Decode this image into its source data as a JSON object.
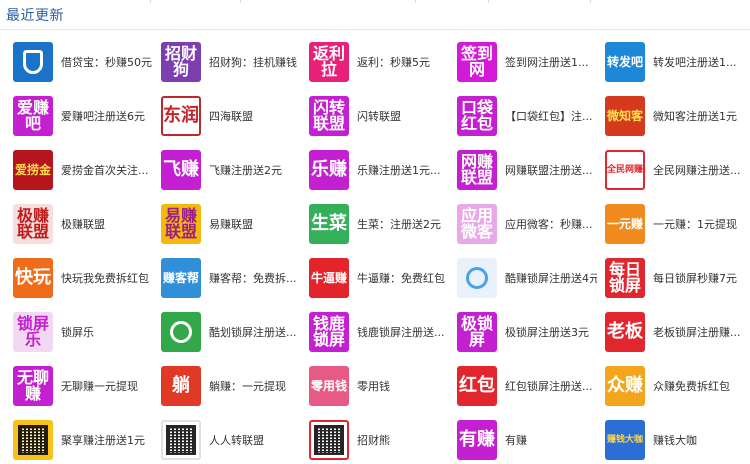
{
  "header": {
    "title": "最近更新"
  },
  "apps": [
    {
      "label": "借贷宝：秒赚50元",
      "icon_text": "",
      "icon_name": "jiedaibao-shield-icon",
      "bg": "#1a73c9",
      "fg": "#ffffff",
      "glyph": "shield"
    },
    {
      "label": "招财狗：挂机赚钱",
      "icon_text": "招财\n狗",
      "icon_name": "zhaocaigou-icon",
      "bg": "#7b3fb0",
      "fg": "#ffffff"
    },
    {
      "label": "返利：秒赚5元",
      "icon_text": "返利\n拉",
      "icon_name": "fanli-icon",
      "bg": "#e8207a",
      "fg": "#ffffff"
    },
    {
      "label": "签到网注册送1...",
      "icon_text": "签到\n网",
      "icon_name": "qiandaowang-icon",
      "bg": "#d21ad8",
      "fg": "#ffffff"
    },
    {
      "label": "转发吧注册送1...",
      "icon_text": "转发吧",
      "icon_name": "zhuanfaba-icon",
      "bg": "#1e88d8",
      "fg": "#ffffff"
    },
    {
      "label": "爱赚吧注册送6元",
      "icon_text": "爱赚\n吧",
      "icon_name": "aizhuanba-icon",
      "bg": "#c41fd0",
      "fg": "#ffffff"
    },
    {
      "label": "四海联盟",
      "icon_text": "东润",
      "icon_name": "sihai-lianmeng-icon",
      "bg": "#ffffff",
      "fg": "#c0272d",
      "border": "#c0272d"
    },
    {
      "label": "闪转联盟",
      "icon_text": "闪转\n联盟",
      "icon_name": "shanzhuan-lianmeng-icon",
      "bg": "#c41fd0",
      "fg": "#ffffff"
    },
    {
      "label": "【口袋红包】注...",
      "icon_text": "口袋\n红包",
      "icon_name": "koudai-hongbao-icon",
      "bg": "#c41fd0",
      "fg": "#ffffff"
    },
    {
      "label": "微知客注册送1元",
      "icon_text": "微知客",
      "icon_name": "weizhike-icon",
      "bg": "#d63a1e",
      "fg": "#ffe14a"
    },
    {
      "label": "爱捞金首次关注...",
      "icon_text": "爱捞金",
      "icon_name": "ailaojin-icon",
      "bg": "#b5161d",
      "fg": "#ffdc4a"
    },
    {
      "label": "飞赚注册送2元",
      "icon_text": "飞赚",
      "icon_name": "feizhuan-icon",
      "bg": "#c41fd0",
      "fg": "#ffffff"
    },
    {
      "label": "乐赚注册送1元...",
      "icon_text": "乐赚",
      "icon_name": "lezhuan-icon",
      "bg": "#c41fd0",
      "fg": "#ffffff"
    },
    {
      "label": "网赚联盟注册送...",
      "icon_text": "网赚\n联盟",
      "icon_name": "wangzhuan-lianmeng-icon",
      "bg": "#c41fd0",
      "fg": "#ffffff"
    },
    {
      "label": "全民网赚注册送...",
      "icon_text": "全民网赚",
      "icon_name": "quanmin-wangzhuan-icon",
      "bg": "#ffffff",
      "fg": "#e0262e",
      "border": "#e0262e"
    },
    {
      "label": "极赚联盟",
      "icon_text": "极赚\n联盟",
      "icon_name": "jizhuan-lianmeng-icon",
      "bg": "#f4dede",
      "fg": "#c21b1b"
    },
    {
      "label": "易赚联盟",
      "icon_text": "易赚\n联盟",
      "icon_name": "yizhuan-lianmeng-icon",
      "bg": "#f5b90d",
      "fg": "#9b1d8c"
    },
    {
      "label": "生菜：注册送2元",
      "icon_text": "生菜",
      "icon_name": "shengcai-icon",
      "bg": "#35b05a",
      "fg": "#ffffff"
    },
    {
      "label": "应用微客：秒赚...",
      "icon_text": "应用\n微客",
      "icon_name": "yingyong-weike-icon",
      "bg": "#e7a9e7",
      "fg": "#ffffff"
    },
    {
      "label": "一元赚：1元提现",
      "icon_text": "一元赚",
      "icon_name": "yiyuanzhuan-icon",
      "bg": "#f08a1c",
      "fg": "#ffffff"
    },
    {
      "label": "快玩我免费拆红包",
      "icon_text": "快玩",
      "icon_name": "kuaiwan-icon",
      "bg": "#ef6d1a",
      "fg": "#ffffff"
    },
    {
      "label": "赚客帮：免费拆...",
      "icon_text": "赚客帮",
      "icon_name": "zhuankebang-icon",
      "bg": "#2f8fd8",
      "fg": "#ffffff"
    },
    {
      "label": "牛逼赚：免费红包",
      "icon_text": "牛逼赚",
      "icon_name": "niubizhuan-icon",
      "bg": "#e3242b",
      "fg": "#ffffff"
    },
    {
      "label": "酷赚锁屏注册送4元",
      "icon_text": "",
      "icon_name": "kuzhuan-lock-icon",
      "bg": "#e9f2fb",
      "fg": "#4aa3e8",
      "glyph": "lock"
    },
    {
      "label": "每日锁屏秒赚7元",
      "icon_text": "每日\n锁屏",
      "icon_name": "meiri-suoping-icon",
      "bg": "#e0262e",
      "fg": "#ffffff"
    },
    {
      "label": "锁屏乐",
      "icon_text": "锁屏\n乐",
      "icon_name": "suopingle-icon",
      "bg": "#f3d8f3",
      "fg": "#c41fd0"
    },
    {
      "label": "酷划锁屏注册送...",
      "icon_text": "",
      "icon_name": "kuhua-lock-icon",
      "bg": "#33a84a",
      "fg": "#ffffff",
      "glyph": "lock"
    },
    {
      "label": "钱鹿锁屏注册送...",
      "icon_text": "钱鹿\n锁屏",
      "icon_name": "qianlu-suoping-icon",
      "bg": "#c41fd0",
      "fg": "#ffffff"
    },
    {
      "label": "极锁屏注册送3元",
      "icon_text": "极锁\n屏",
      "icon_name": "jisuoping-icon",
      "bg": "#c41fd0",
      "fg": "#ffffff"
    },
    {
      "label": "老板锁屏注册赚...",
      "icon_text": "老板",
      "icon_name": "laoban-suoping-icon",
      "bg": "#e2262d",
      "fg": "#ffffff"
    },
    {
      "label": "无聊赚一元提现",
      "icon_text": "无聊\n赚",
      "icon_name": "wuliaozhuan-icon",
      "bg": "#c41fd0",
      "fg": "#ffffff"
    },
    {
      "label": "躺赚：一元提现",
      "icon_text": "躺",
      "icon_name": "tangzhuan-icon",
      "bg": "#e03a26",
      "fg": "#ffffff"
    },
    {
      "label": "零用钱",
      "icon_text": "零用钱",
      "icon_name": "lingyongqian-icon",
      "bg": "#e85a86",
      "fg": "#ffffff"
    },
    {
      "label": "红包锁屏注册送...",
      "icon_text": "红包",
      "icon_name": "hongbao-suoping-icon",
      "bg": "#e2262d",
      "fg": "#ffffff"
    },
    {
      "label": "众赚免费拆红包",
      "icon_text": "众赚",
      "icon_name": "zhongzhuan-icon",
      "bg": "#f4a51c",
      "fg": "#ffffff"
    },
    {
      "label": "聚享赚注册送1元",
      "icon_text": "",
      "icon_name": "qr-code-icon",
      "bg": "#f6c21b",
      "fg": "#000000",
      "glyph": "qr"
    },
    {
      "label": "人人转联盟",
      "icon_text": "",
      "icon_name": "qr-code-icon",
      "bg": "#ffffff",
      "fg": "#000000",
      "glyph": "qr",
      "border": "#e0e0e0"
    },
    {
      "label": "招财熊",
      "icon_text": "",
      "icon_name": "qr-code-icon",
      "bg": "#ffffff",
      "fg": "#000000",
      "glyph": "qr",
      "border": "#e0262e"
    },
    {
      "label": "有赚",
      "icon_text": "有赚",
      "icon_name": "youzhuan-icon",
      "bg": "#c41fd0",
      "fg": "#ffffff"
    },
    {
      "label": "赚钱大咖",
      "icon_text": "赚钱大咖",
      "icon_name": "zhuanqian-daka-icon",
      "bg": "#2b6fd6",
      "fg": "#ffd54a"
    }
  ]
}
